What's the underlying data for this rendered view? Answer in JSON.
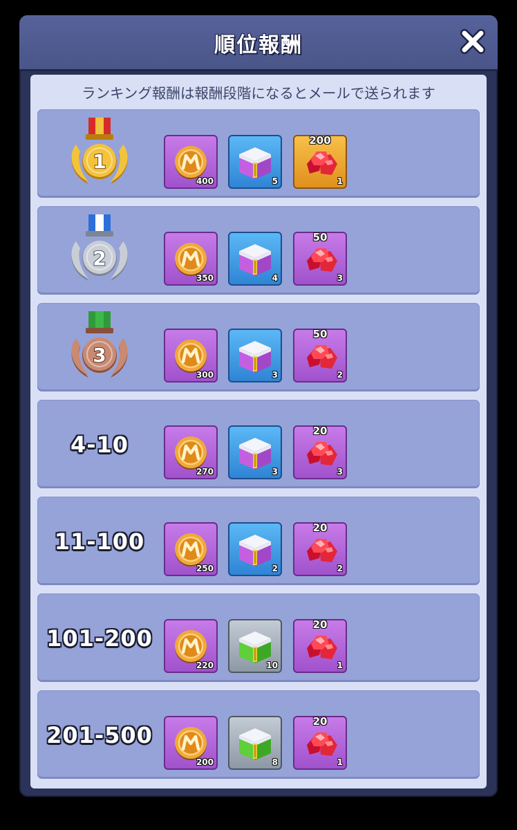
{
  "dialog": {
    "title": "順位報酬",
    "subtitle": "ランキング報酬は報酬段階になるとメールで送られます"
  },
  "colors": {
    "panel_bg": "#2b3358",
    "row_bg": "#96a3d8",
    "gold": "#f3c33c",
    "silver": "#c9ced6",
    "bronze": "#c98a72"
  },
  "tiers": [
    {
      "rank": "1",
      "rewards": [
        {
          "kind": "coin",
          "icon": "m-coin-icon",
          "count": "400"
        },
        {
          "kind": "chest",
          "icon": "purple-chest-icon",
          "count": "5"
        },
        {
          "kind": "ruby",
          "icon": "ruby-pile-icon",
          "label": "200",
          "count": "1",
          "tile": "orange"
        }
      ]
    },
    {
      "rank": "2",
      "rewards": [
        {
          "kind": "coin",
          "icon": "m-coin-icon",
          "count": "350"
        },
        {
          "kind": "chest",
          "icon": "purple-chest-icon",
          "count": "4"
        },
        {
          "kind": "ruby",
          "icon": "ruby-pile-icon",
          "label": "50",
          "count": "3",
          "tile": "purple"
        }
      ]
    },
    {
      "rank": "3",
      "rewards": [
        {
          "kind": "coin",
          "icon": "m-coin-icon",
          "count": "300"
        },
        {
          "kind": "chest",
          "icon": "purple-chest-icon",
          "count": "3"
        },
        {
          "kind": "ruby",
          "icon": "ruby-pile-icon",
          "label": "50",
          "count": "2",
          "tile": "purple"
        }
      ]
    },
    {
      "rank": "4-10",
      "rewards": [
        {
          "kind": "coin",
          "icon": "m-coin-icon",
          "count": "270"
        },
        {
          "kind": "chest",
          "icon": "purple-chest-icon",
          "count": "3"
        },
        {
          "kind": "ruby",
          "icon": "ruby-pile-icon",
          "label": "20",
          "count": "3",
          "tile": "purple"
        }
      ]
    },
    {
      "rank": "11-100",
      "rewards": [
        {
          "kind": "coin",
          "icon": "m-coin-icon",
          "count": "250"
        },
        {
          "kind": "chest",
          "icon": "purple-chest-icon",
          "count": "2"
        },
        {
          "kind": "ruby",
          "icon": "ruby-pile-icon",
          "label": "20",
          "count": "2",
          "tile": "purple"
        }
      ]
    },
    {
      "rank": "101-200",
      "rewards": [
        {
          "kind": "coin",
          "icon": "m-coin-icon",
          "count": "220"
        },
        {
          "kind": "chest",
          "icon": "green-chest-icon",
          "count": "10"
        },
        {
          "kind": "ruby",
          "icon": "ruby-pile-icon",
          "label": "20",
          "count": "1",
          "tile": "purple"
        }
      ]
    },
    {
      "rank": "201-500",
      "rewards": [
        {
          "kind": "coin",
          "icon": "m-coin-icon",
          "count": "200"
        },
        {
          "kind": "chest",
          "icon": "green-chest-icon",
          "count": "8"
        },
        {
          "kind": "ruby",
          "icon": "ruby-pile-icon",
          "label": "20",
          "count": "1",
          "tile": "purple"
        }
      ]
    }
  ]
}
